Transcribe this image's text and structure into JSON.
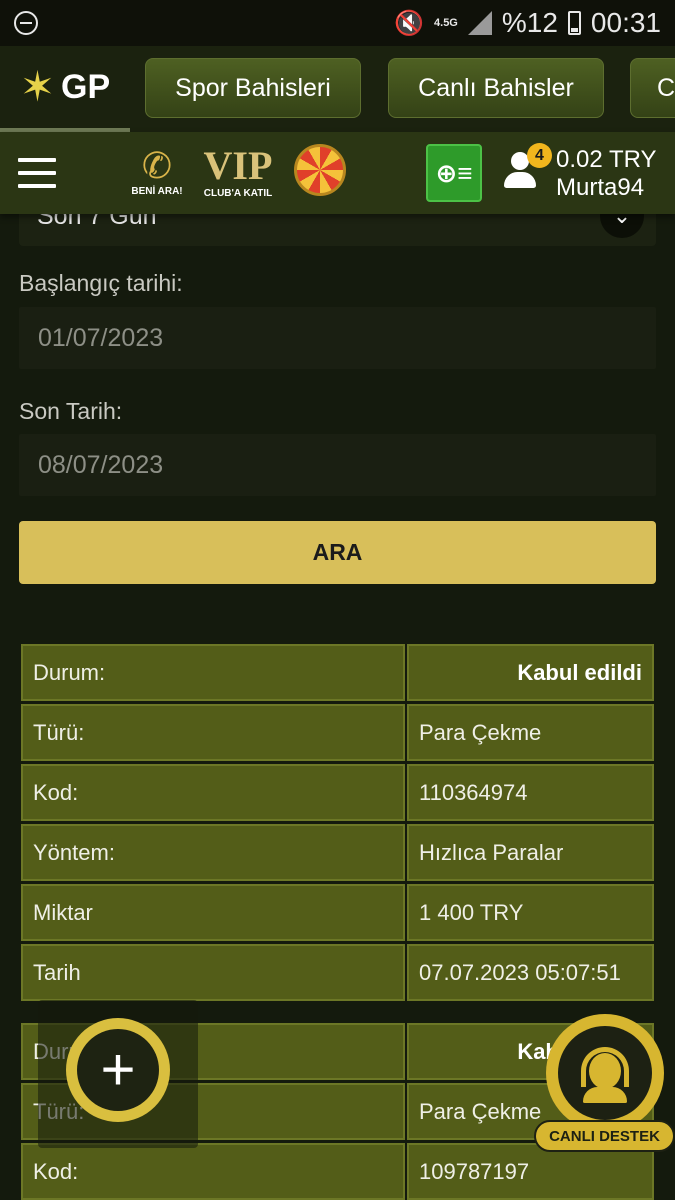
{
  "status_bar": {
    "network": "4.5G",
    "battery": "%12",
    "time": "00:31"
  },
  "logo": {
    "text": "GP"
  },
  "top_tabs": [
    {
      "label": "Spor Bahisleri"
    },
    {
      "label": "Canlı Bahisler"
    },
    {
      "label": "C"
    }
  ],
  "header": {
    "call_caption": "BENİ ARA!",
    "vip_text": "VIP",
    "vip_caption": "CLUB'A KATIL",
    "notification_count": "4",
    "balance": "0.02 TRY",
    "username": "Murta94"
  },
  "filter": {
    "period_selected": "Son 7 Gün",
    "start_label": "Başlangıç tarihi:",
    "start_value": "01/07/2023",
    "end_label": "Son Tarih:",
    "end_value": "08/07/2023",
    "search_button": "ARA"
  },
  "transactions": [
    {
      "rows": [
        {
          "label": "Durum:",
          "value": "Kabul edildi"
        },
        {
          "label": "Türü:",
          "value": "Para Çekme"
        },
        {
          "label": "Kod:",
          "value": "110364974"
        },
        {
          "label": "Yöntem:",
          "value": "Hızlıca Paralar"
        },
        {
          "label": "Miktar",
          "value": "1 400 TRY"
        },
        {
          "label": "Tarih",
          "value": "07.07.2023 05:07:51"
        }
      ]
    },
    {
      "rows": [
        {
          "label": "Durum:",
          "value": "Kabul edildi"
        },
        {
          "label": "Türü:",
          "value": "Para Çekme"
        },
        {
          "label": "Kod:",
          "value": "109787197"
        }
      ]
    }
  ],
  "support": {
    "caption": "CANLI DESTEK"
  },
  "colors": {
    "accent_gold": "#d8bf5a",
    "header_green": "#2b3614",
    "cell_olive": "#535d18",
    "deposit_green": "#2e9b2a"
  }
}
